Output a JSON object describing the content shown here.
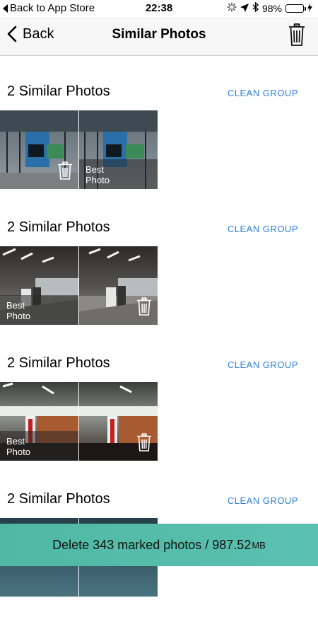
{
  "status_bar": {
    "back_label": "Back to App Store",
    "time": "22:38",
    "battery": "98%",
    "battery_level": 0.98,
    "icons": [
      "activity-spinner-icon",
      "location-arrow-icon",
      "bluetooth-icon",
      "battery-icon",
      "charging-bolt-icon"
    ]
  },
  "nav": {
    "back_label": "Back",
    "title": "Similar Photos",
    "trash_icon": "trash-icon"
  },
  "groups": [
    {
      "title": "2 Similar Photos",
      "action": "CLEAN GROUP",
      "photos": [
        {
          "best": false,
          "marked": true
        },
        {
          "best": true,
          "best_label": "Best Photo"
        }
      ]
    },
    {
      "title": "2 Similar Photos",
      "action": "CLEAN GROUP",
      "photos": [
        {
          "best": true,
          "best_label": "Best Photo"
        },
        {
          "best": false,
          "marked": true
        }
      ]
    },
    {
      "title": "2 Similar Photos",
      "action": "CLEAN GROUP",
      "photos": [
        {
          "best": true,
          "best_label": "Best Photo"
        },
        {
          "best": false,
          "marked": true
        }
      ]
    },
    {
      "title": "2 Similar Photos",
      "action": "CLEAN GROUP",
      "photos": [
        {
          "best": false
        },
        {
          "best": false
        }
      ]
    }
  ],
  "bottom": {
    "text": "Delete 343 marked photos / 987.52",
    "unit": "MB"
  },
  "colors": {
    "accent": "#2f80d6",
    "bottom_bar": "#54bca8",
    "battery": "#4cd964"
  }
}
